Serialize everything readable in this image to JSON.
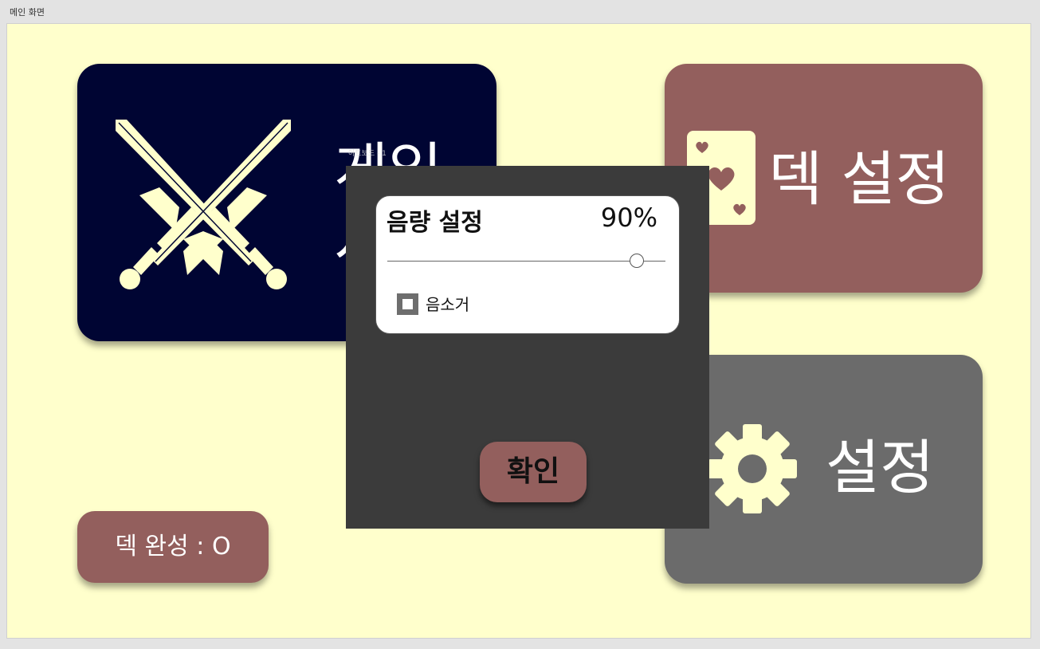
{
  "window": {
    "title": "메인 화면"
  },
  "colors": {
    "background": "#ffffcc",
    "navy": "#000533",
    "rose": "#935f5d",
    "gray": "#6b6b6b",
    "modal": "#3b3b3b",
    "cream_icon": "#ffffcc"
  },
  "menu": {
    "game_button": {
      "label": "게임 시작",
      "icon": "crossed-swords-icon"
    },
    "deck_button": {
      "label": "덱 설정",
      "icon": "playing-card-hearts-icon"
    },
    "settings_button": {
      "label": "설정",
      "icon": "gear-icon"
    },
    "deck_status": {
      "label": "덱 완성 : O"
    }
  },
  "volume_dialog": {
    "tag": "아트보드 - 1",
    "title": "음량 설정",
    "volume_percent_text": "90%",
    "volume_value": 0.9,
    "mute_label": "음소거",
    "mute_checked": false,
    "confirm_label": "확인"
  }
}
